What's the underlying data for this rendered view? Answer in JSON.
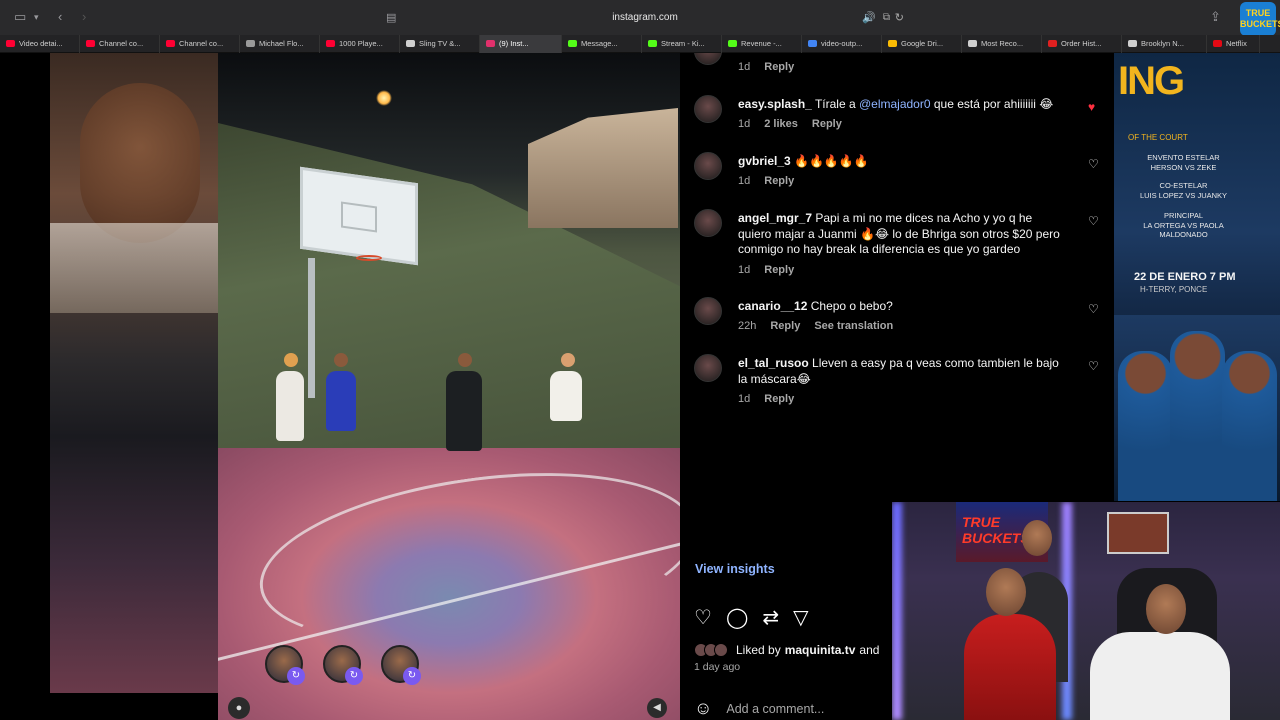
{
  "browser": {
    "url": "instagram.com",
    "tabs": [
      {
        "label": "Video detai...",
        "color": "#ff0033"
      },
      {
        "label": "Channel co...",
        "color": "#ff0033"
      },
      {
        "label": "Channel co...",
        "color": "#ff0033"
      },
      {
        "label": "Michael Flo...",
        "color": "#9a9a9a"
      },
      {
        "label": "1000 Playe...",
        "color": "#ff0033"
      },
      {
        "label": "Sling TV &...",
        "color": "#cfcfcf"
      },
      {
        "label": "(9) Inst...",
        "color": "#e1306c"
      },
      {
        "label": "Message...",
        "color": "#53fc18"
      },
      {
        "label": "Stream - Ki...",
        "color": "#53fc18"
      },
      {
        "label": "Revenue -...",
        "color": "#53fc18"
      },
      {
        "label": "video-outp...",
        "color": "#4285f4"
      },
      {
        "label": "Google Dri...",
        "color": "#fbbc04"
      },
      {
        "label": "Most Reco...",
        "color": "#cfcfcf"
      },
      {
        "label": "Order Hist...",
        "color": "#e02020"
      },
      {
        "label": "Brooklyn N...",
        "color": "#cfcfcf"
      },
      {
        "label": "Netflix",
        "color": "#e50914"
      }
    ]
  },
  "comments": [
    {
      "meta": [
        "1d",
        "Reply"
      ]
    },
    {
      "user": "easy.splash_",
      "text_before": " Tírale a ",
      "mention": "@elmajador0",
      "text_after": " que está por ahiiiiiii 😂",
      "meta": [
        "1d",
        "2 likes",
        "Reply"
      ],
      "liked": true
    },
    {
      "user": "gvbriel_3",
      "text": " 🔥🔥🔥🔥🔥",
      "meta": [
        "1d",
        "Reply"
      ]
    },
    {
      "user": "angel_mgr_7",
      "text": " Papi a mi no me dices na Acho y yo q he quiero majar a Juanmi 🔥😂 lo de Bhriga son otros $20 pero conmigo no hay break la diferencia es que yo gardeo",
      "meta": [
        "1d",
        "Reply"
      ]
    },
    {
      "user": "canario__12",
      "text": " Chepo o bebo?",
      "meta": [
        "22h",
        "Reply",
        "See translation"
      ]
    },
    {
      "user": "el_tal_rusoo",
      "text": " Lleven a easy pa q veas como tambien le bajo la máscara😂",
      "meta": [
        "1d",
        "Reply"
      ]
    }
  ],
  "post": {
    "view_insights": "View insights",
    "liked_by_prefix": "Liked by",
    "liked_by_user": "maquinita.tv",
    "liked_by_suffix": "and",
    "date": "1 day ago",
    "add_comment_placeholder": "Add a comment..."
  },
  "poster": {
    "title": "ING",
    "subtitle": "OF THE COURT",
    "lines": [
      "ENVENTO ESTELAR",
      "HERSON VS ZEKE",
      "CO-ESTELAR",
      "LUIS LOPEZ VS JUANKY",
      "PRINCIPAL",
      "LA ORTEGA VS PAOLA MALDONADO"
    ],
    "date": "22 DE ENERO 7 PM",
    "place": "H-TERRY, PONCE"
  },
  "overlay_logo": "TRUE BUCKETS",
  "webcam": {
    "banner": "TRUE BUCKETS"
  },
  "colors": {
    "accent_link": "#8fb4ff",
    "like_red": "#ff3040",
    "meta_gray": "#a8a8a8"
  }
}
